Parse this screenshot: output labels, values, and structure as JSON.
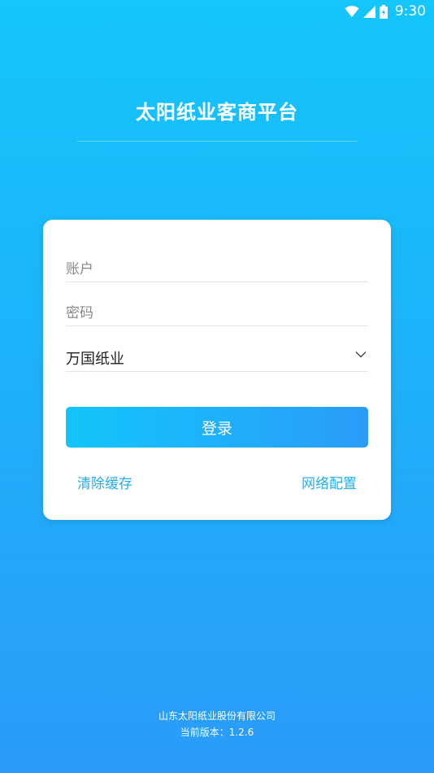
{
  "status_bar": {
    "time": "9:30",
    "icons": [
      "wifi-icon",
      "cellular-signal-icon",
      "battery-icon"
    ]
  },
  "app": {
    "title": "太阳纸业客商平台"
  },
  "login_form": {
    "account_placeholder": "账户",
    "account_value": "",
    "password_placeholder": "密码",
    "password_value": "",
    "company_selected": "万国纸业",
    "login_label": "登录",
    "clear_cache_label": "清除缓存",
    "network_config_label": "网络配置"
  },
  "footer": {
    "company": "山东太阳纸业股份有限公司",
    "version": "当前版本：1.2.6"
  },
  "colors": {
    "background_top": "#14c6fb",
    "background_bottom": "#2a9bf8",
    "accent": "#25aef0",
    "card": "#ffffff"
  }
}
